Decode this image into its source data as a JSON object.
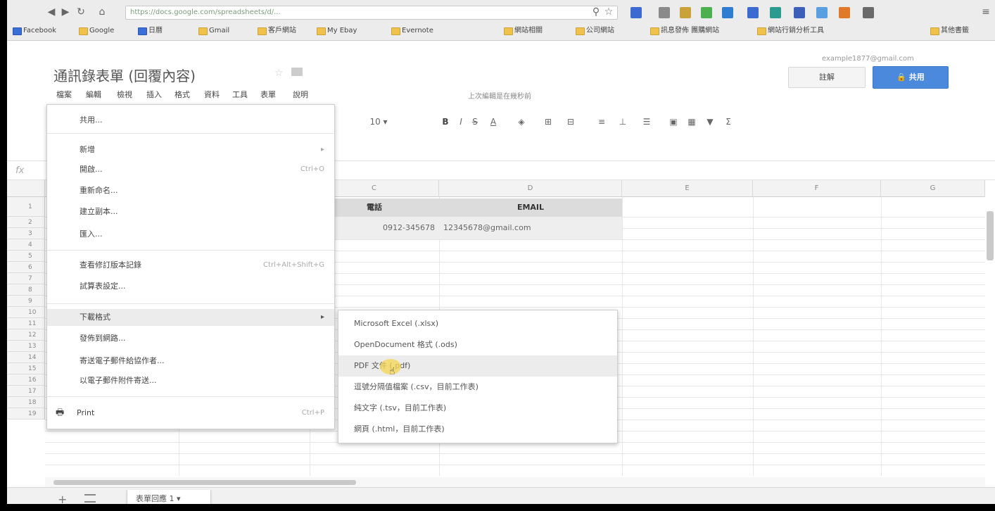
{
  "browser": {
    "url": "https://docs.google.com/spreadsheets/d/...",
    "bookmarks": [
      "Facebook",
      "Google",
      "日曆",
      "Gmail",
      "客戶網站",
      "My Ebay",
      "Evernote",
      "網站相關",
      "公司網站",
      "訊息發佈 團購網站",
      "網站行銷分析工具",
      "其他書籤"
    ]
  },
  "app": {
    "doc_title": "通訊錄表單 (回覆內容)",
    "account": "example1877@gmail.com",
    "comment_label": "註解",
    "share_label": "共用",
    "edit_hint": "上次編輯是在幾秒前"
  },
  "menubar": [
    "檔案",
    "編輯",
    "檢視",
    "插入",
    "格式",
    "資料",
    "工具",
    "表單",
    "說明"
  ],
  "grid": {
    "columns": [
      "C",
      "D",
      "E",
      "F",
      "G"
    ],
    "row_numbers": [
      "1",
      "2",
      "3",
      "4",
      "5",
      "6",
      "7",
      "8",
      "9",
      "10",
      "11",
      "12",
      "13",
      "14",
      "15",
      "16",
      "17",
      "18",
      "19"
    ],
    "header_row": {
      "C": "電話",
      "D": "EMAIL"
    },
    "data_row": {
      "C": "0912-345678",
      "D": "12345678@gmail.com"
    }
  },
  "file_menu": {
    "items": [
      {
        "label": "共用...",
        "shortcut": ""
      },
      {
        "label": "新增",
        "shortcut": "▸"
      },
      {
        "label": "開啟...",
        "shortcut": "Ctrl+O"
      },
      {
        "label": "重新命名...",
        "shortcut": ""
      },
      {
        "label": "建立副本...",
        "shortcut": ""
      },
      {
        "label": "匯入...",
        "shortcut": ""
      },
      {
        "label": "查看修訂版本記錄",
        "shortcut": "Ctrl+Alt+Shift+G"
      },
      {
        "label": "試算表設定...",
        "shortcut": ""
      },
      {
        "label": "下載格式",
        "shortcut": "▸"
      },
      {
        "label": "發佈到網路...",
        "shortcut": ""
      },
      {
        "label": "寄送電子郵件給協作者...",
        "shortcut": ""
      },
      {
        "label": "以電子郵件附件寄送...",
        "shortcut": ""
      },
      {
        "label": "Print",
        "shortcut": "Ctrl+P"
      }
    ]
  },
  "download_submenu": [
    "Microsoft Excel (.xlsx)",
    "OpenDocument 格式 (.ods)",
    "PDF 文件 (.pdf)",
    "逗號分隔值檔案 (.csv，目前工作表)",
    "純文字 (.tsv，目前工作表)",
    "網頁 (.html，目前工作表)"
  ],
  "sheet_tab": "表單回應 1"
}
